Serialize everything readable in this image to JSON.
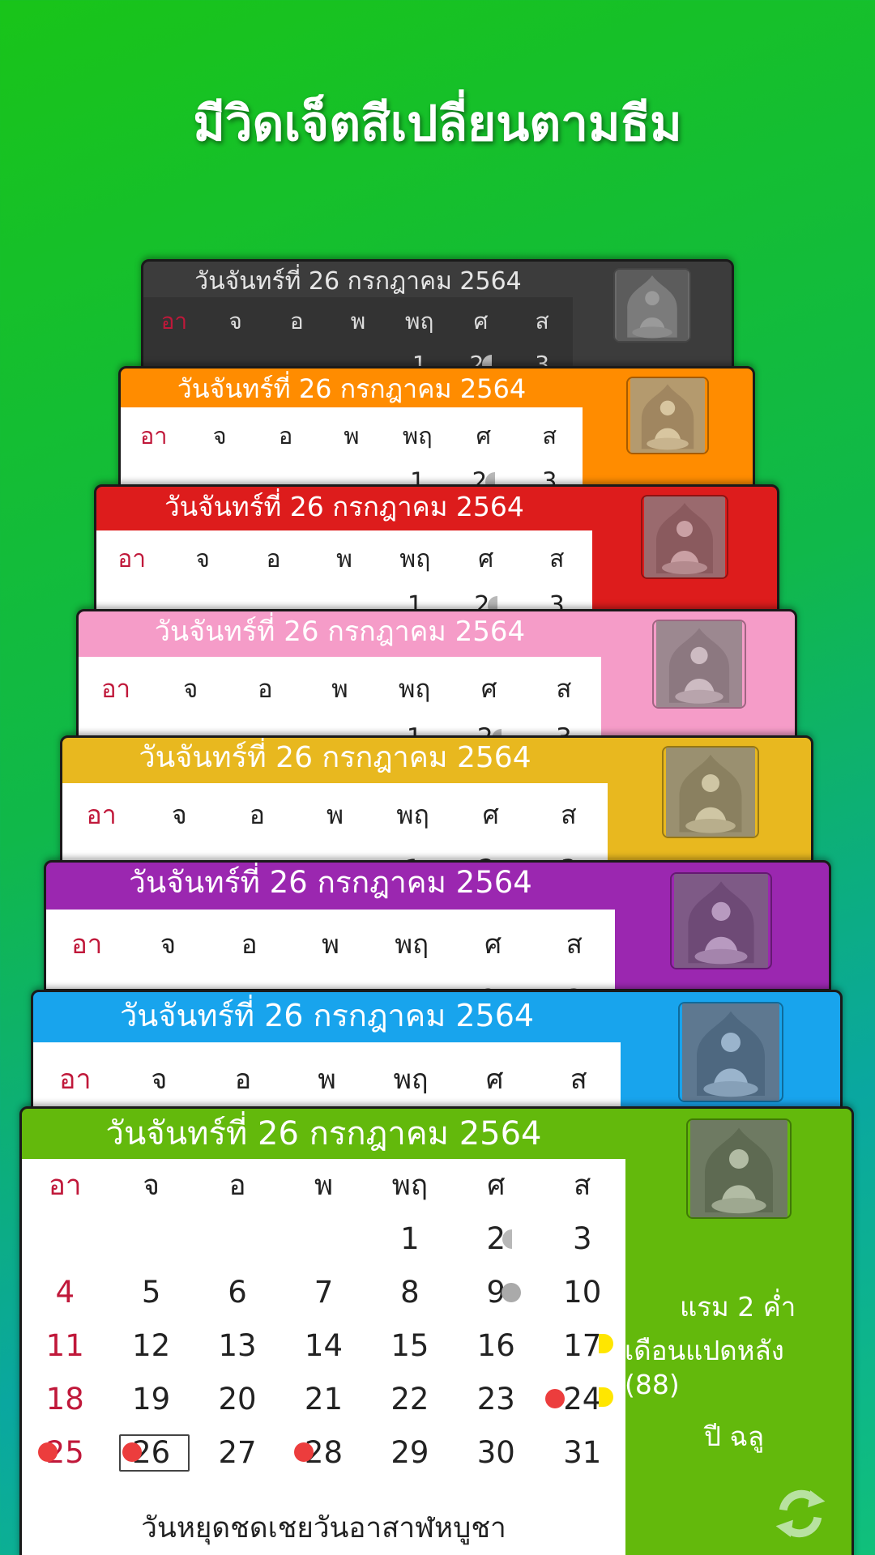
{
  "headline": "มีวิดเจ็ตสีเปลี่ยนตามธีม",
  "widget_title": "วันจันทร์ที่ 26 กรกฎาคม 2564",
  "weekdays": [
    "อา",
    "จ",
    "อ",
    "พ",
    "พฤ",
    "ศ",
    "ส"
  ],
  "colors": {
    "dark": "#3c3c3c",
    "orange": "#ff8c00",
    "red": "#dd1c1c",
    "pink": "#f59cc8",
    "yellow": "#e8b81f",
    "purple": "#9b27b0",
    "blue": "#18a4ed",
    "green": "#63b90c",
    "sunday_text": "#c0183a"
  },
  "calendar": {
    "weeks": [
      [
        "",
        "",
        "",
        "",
        "1",
        "2",
        "3"
      ],
      [
        "4",
        "5",
        "6",
        "7",
        "8",
        "9",
        "10"
      ],
      [
        "11",
        "12",
        "13",
        "14",
        "15",
        "16",
        "17"
      ],
      [
        "18",
        "19",
        "20",
        "21",
        "22",
        "23",
        "24"
      ],
      [
        "25",
        "26",
        "27",
        "28",
        "29",
        "30",
        "31"
      ]
    ],
    "today": "26",
    "holiday_note": "วันหยุดชดเชยวันอาสาฬหบูชา"
  },
  "lunar": {
    "line1": "แรม 2 ค่ำ",
    "line2": "เดือนแปดหลัง",
    "line3": "(88)",
    "line4": "ปี ฉลู"
  },
  "icons": {
    "image": "buddha-image-icon",
    "refresh": "refresh-icon"
  }
}
